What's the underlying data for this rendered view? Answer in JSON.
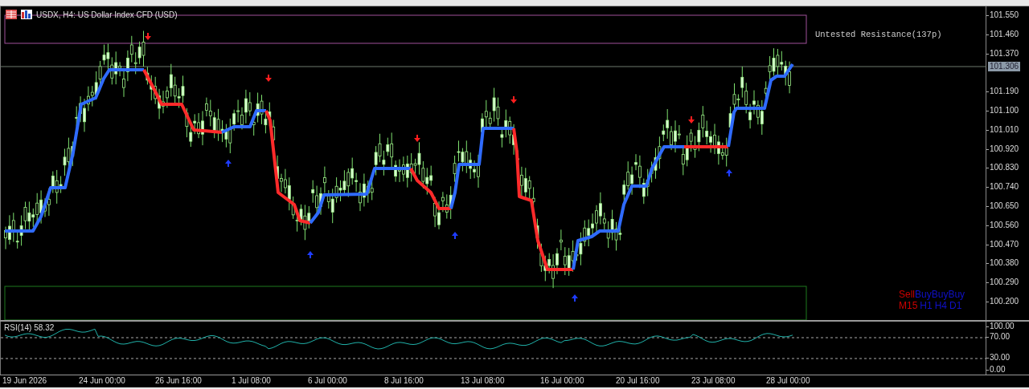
{
  "chart": {
    "title": "USDX, H4:  US Dollar Index CFD (USD)",
    "zone_label": "Untested Resistance(137p)",
    "current_price": "101.306",
    "price_axis": [
      "101.550",
      "101.460",
      "101.370",
      "101.190",
      "101.100",
      "101.010",
      "100.920",
      "100.830",
      "100.740",
      "100.650",
      "100.560",
      "100.470",
      "100.380",
      "100.290",
      "100.200"
    ],
    "signals": [
      {
        "signal": "Sell",
        "timeframe": "M15",
        "color": "#cc0000"
      },
      {
        "signal": "Buy",
        "timeframe": "H1",
        "color": "#1010c8"
      },
      {
        "signal": "Buy",
        "timeframe": "H4",
        "color": "#1010c8"
      },
      {
        "signal": "Buy",
        "timeframe": "D1",
        "color": "#1010c8"
      }
    ]
  },
  "rsi": {
    "label": "RSI(14) 58.32",
    "axis": [
      "100.00",
      "70.00",
      "30.00",
      "0.00"
    ]
  },
  "time_axis": [
    "19 Jun 2026",
    "24 Jun 00:00",
    "26 Jun 16:00",
    "1 Jul 08:00",
    "6 Jul 00:00",
    "8 Jul 16:00",
    "13 Jul 08:00",
    "16 Jul 00:00",
    "20 Jul 16:00",
    "23 Jul 08:00",
    "28 Jul 00:00"
  ]
}
